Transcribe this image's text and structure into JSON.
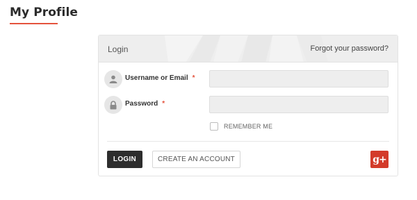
{
  "page": {
    "title": "My Profile"
  },
  "login_panel": {
    "header_title": "Login",
    "forgot_link": "Forgot your password?",
    "username": {
      "label": "Username or Email",
      "required_mark": "*",
      "value": "",
      "placeholder": ""
    },
    "password": {
      "label": "Password",
      "required_mark": "*",
      "value": "",
      "placeholder": ""
    },
    "remember_me": {
      "label": "REMEMBER ME",
      "checked": false
    },
    "login_button": "LOGIN",
    "create_account_button": "CREATE AN ACCOUNT",
    "social_login": {
      "icon": "google-plus-icon",
      "label": "g+"
    }
  },
  "colors": {
    "accent": "#e4533d",
    "login_button_bg": "#2d2d2d",
    "google_red": "#d33b2a",
    "header_bg": "#eeeeee"
  }
}
